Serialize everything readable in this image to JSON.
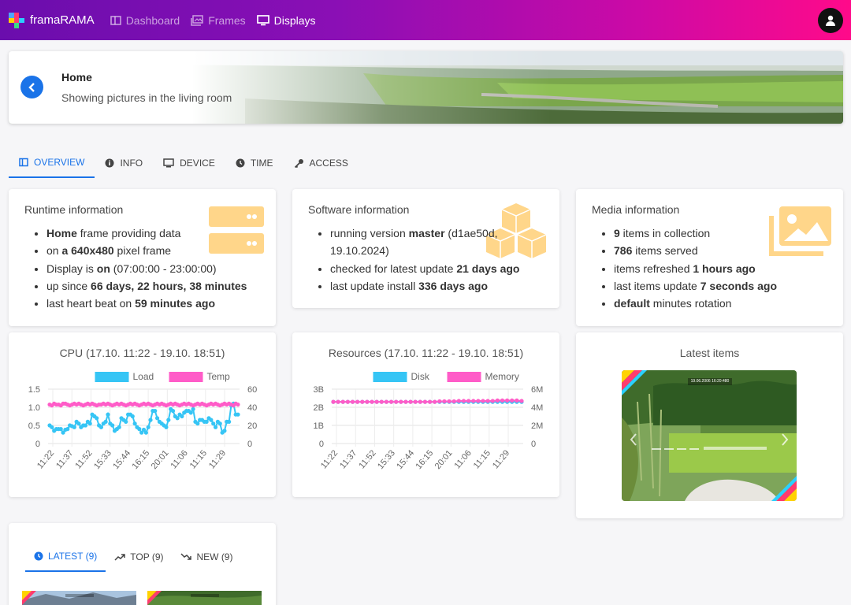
{
  "app": {
    "name": "framaRAMA"
  },
  "nav": {
    "items": [
      {
        "label": "Dashboard"
      },
      {
        "label": "Frames"
      },
      {
        "label": "Displays"
      }
    ]
  },
  "header": {
    "title": "Home",
    "subtitle": "Showing pictures in the living room"
  },
  "tabs": [
    {
      "label": "OVERVIEW"
    },
    {
      "label": "INFO"
    },
    {
      "label": "DEVICE"
    },
    {
      "label": "TIME"
    },
    {
      "label": "ACCESS"
    }
  ],
  "runtime": {
    "title": "Runtime information",
    "items": [
      {
        "pre": "",
        "b": "Home",
        "post": " frame providing data"
      },
      {
        "pre": "on ",
        "b": "a 640x480",
        "post": " pixel frame"
      },
      {
        "pre": "Display is ",
        "b": "on",
        "post": " (07:00:00 - 23:00:00)"
      },
      {
        "pre": "up since ",
        "b": "66 days, 22 hours, 38 minutes",
        "post": ""
      },
      {
        "pre": "last heart beat on ",
        "b": "59 minutes ago",
        "post": ""
      }
    ]
  },
  "software": {
    "title": "Software information",
    "items": [
      {
        "pre": "running version ",
        "b": "master",
        "post": " (d1ae50d, 19.10.2024)"
      },
      {
        "pre": "checked for latest update ",
        "b": "21 days ago",
        "post": ""
      },
      {
        "pre": "last update install ",
        "b": "336 days ago",
        "post": ""
      }
    ]
  },
  "media": {
    "title": "Media information",
    "items": [
      {
        "pre": "",
        "b": "9",
        "post": " items in collection"
      },
      {
        "pre": "",
        "b": "786",
        "post": " items served"
      },
      {
        "pre": "items refreshed ",
        "b": "1 hours ago",
        "post": ""
      },
      {
        "pre": "last items update ",
        "b": "7 seconds ago",
        "post": ""
      },
      {
        "pre": "",
        "b": "default",
        "post": " minutes rotation"
      }
    ]
  },
  "latest_items": {
    "title": "Latest items",
    "photo_caption": "19.06.2006 16:20:480"
  },
  "bottom_tabs": [
    {
      "label": "LATEST (9)"
    },
    {
      "label": "TOP (9)"
    },
    {
      "label": "NEW (9)"
    }
  ],
  "colors": {
    "accent": "#1a73e8",
    "series1": "#36c5f5",
    "series2": "#ff5cc8"
  },
  "chart_data": [
    {
      "type": "line",
      "title": "CPU (17.10. 11:22 - 19.10. 18:51)",
      "x_ticks": [
        "11:22",
        "11:37",
        "11:52",
        "15:33",
        "15:44",
        "16:15",
        "20:01",
        "11:06",
        "11:15",
        "11:29"
      ],
      "y_left_ticks": [
        "0",
        "0.5",
        "1.0",
        "1.5"
      ],
      "y_right_ticks": [
        "0",
        "20",
        "40",
        "60"
      ],
      "ylim": [
        0,
        1.5
      ],
      "y2lim": [
        0,
        60
      ],
      "series": [
        {
          "name": "Load",
          "axis": "left",
          "values": [
            0.5,
            0.45,
            0.35,
            0.4,
            0.4,
            0.4,
            0.3,
            0.38,
            0.4,
            0.5,
            0.48,
            0.45,
            0.6,
            0.55,
            0.45,
            0.5,
            0.5,
            0.6,
            0.55,
            0.8,
            0.75,
            0.7,
            0.5,
            0.45,
            0.55,
            0.6,
            0.8,
            0.55,
            0.5,
            0.35,
            0.4,
            0.45,
            0.7,
            0.65,
            0.6,
            0.8,
            0.8,
            0.75,
            0.55,
            0.45,
            0.4,
            0.3,
            0.38,
            0.3,
            0.45,
            0.65,
            0.9,
            0.9,
            0.7,
            0.6,
            0.55,
            0.5,
            0.45,
            0.65,
            0.95,
            0.9,
            0.75,
            0.7,
            0.8,
            0.75,
            0.85,
            0.9,
            0.9,
            0.85,
            0.95,
            0.6,
            0.55,
            0.65,
            0.65,
            0.6,
            0.6,
            0.7,
            0.65,
            0.55,
            0.45,
            0.6,
            0.55,
            0.3,
            0.35,
            0.6,
            0.6,
            1.05,
            1.1,
            0.8,
            0.8
          ]
        },
        {
          "name": "Temp",
          "axis": "right",
          "values": [
            43,
            42,
            44,
            43,
            43,
            42,
            44,
            44,
            43,
            42,
            43,
            44,
            43,
            44,
            43,
            42,
            43,
            44,
            43,
            44,
            43,
            42,
            43,
            43,
            44,
            43,
            44,
            43,
            42,
            43,
            44,
            43,
            44,
            43,
            42,
            43,
            44,
            43,
            44,
            43,
            42,
            43,
            44,
            43,
            44,
            43,
            42,
            43,
            44,
            43,
            44,
            43,
            42,
            43,
            44,
            43,
            44,
            43,
            42,
            43,
            44,
            43,
            44,
            43,
            42,
            43,
            44,
            43,
            44,
            43,
            42,
            43,
            44,
            43,
            44,
            43,
            42,
            43,
            44,
            43,
            44,
            43,
            42,
            44,
            43
          ]
        }
      ]
    },
    {
      "type": "line",
      "title": "Resources (17.10. 11:22 - 19.10. 18:51)",
      "x_ticks": [
        "11:22",
        "11:37",
        "11:52",
        "15:33",
        "15:44",
        "16:15",
        "20:01",
        "11:06",
        "11:15",
        "11:29"
      ],
      "y_left_ticks": [
        "0",
        "1B",
        "2B",
        "3B"
      ],
      "y_right_ticks": [
        "0",
        "2M",
        "4M",
        "6M"
      ],
      "ylim": [
        0,
        3
      ],
      "y2lim": [
        0,
        6
      ],
      "series": [
        {
          "name": "Disk",
          "axis": "left",
          "values": [
            2.3,
            2.3,
            2.3,
            2.3,
            2.3,
            2.3,
            2.3,
            2.3,
            2.3,
            2.3,
            2.3,
            2.3,
            2.3,
            2.3,
            2.3,
            2.3,
            2.3,
            2.3,
            2.3,
            2.3,
            2.3,
            2.3,
            2.3,
            2.3,
            2.3,
            2.3,
            2.3,
            2.3,
            2.3,
            2.3,
            2.3,
            2.3,
            2.3,
            2.3,
            2.3,
            2.3,
            2.3,
            2.3,
            2.3,
            2.3
          ]
        },
        {
          "name": "Memory",
          "axis": "right",
          "values": [
            4.6,
            4.6,
            4.6,
            4.6,
            4.6,
            4.6,
            4.6,
            4.6,
            4.6,
            4.6,
            4.6,
            4.6,
            4.6,
            4.6,
            4.6,
            4.6,
            4.6,
            4.6,
            4.6,
            4.6,
            4.6,
            4.6,
            4.65,
            4.65,
            4.65,
            4.65,
            4.7,
            4.7,
            4.7,
            4.7,
            4.7,
            4.7,
            4.7,
            4.7,
            4.75,
            4.75,
            4.75,
            4.75,
            4.75,
            4.7
          ]
        }
      ]
    }
  ]
}
